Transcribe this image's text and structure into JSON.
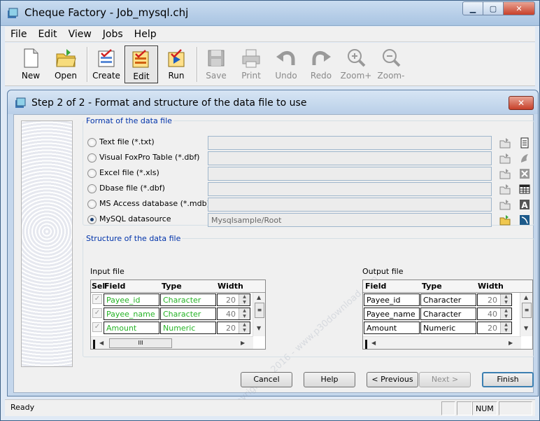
{
  "window": {
    "title": "Cheque Factory - Job_mysql.chj"
  },
  "menu": {
    "items": [
      "File",
      "Edit",
      "View",
      "Jobs",
      "Help"
    ]
  },
  "toolbar": {
    "buttons": [
      {
        "label": "New",
        "icon": "new-document-icon"
      },
      {
        "label": "Open",
        "icon": "open-folder-icon"
      },
      {
        "label": "Create",
        "icon": "create-check-icon"
      },
      {
        "label": "Edit",
        "icon": "edit-check-icon",
        "active": true
      },
      {
        "label": "Run",
        "icon": "run-icon"
      },
      {
        "label": "Save",
        "icon": "save-disk-icon",
        "disabled": true
      },
      {
        "label": "Print",
        "icon": "printer-icon",
        "disabled": true
      },
      {
        "label": "Undo",
        "icon": "undo-arrow-icon",
        "disabled": true
      },
      {
        "label": "Redo",
        "icon": "redo-arrow-icon",
        "disabled": true
      },
      {
        "label": "Zoom+",
        "icon": "zoom-in-icon",
        "disabled": true
      },
      {
        "label": "Zoom-",
        "icon": "zoom-out-icon",
        "disabled": true
      }
    ]
  },
  "dialog": {
    "title": "Step 2 of 2 - Format and structure of the data file to use",
    "format_group": {
      "legend": "Format of the data file",
      "options": [
        {
          "label": "Text file (*.txt)",
          "value": "",
          "checked": false,
          "icon": "notepad-icon"
        },
        {
          "label": "Visual FoxPro Table (*.dbf)",
          "value": "",
          "checked": false,
          "icon": "foxpro-icon"
        },
        {
          "label": "Excel file (*.xls)",
          "value": "",
          "checked": false,
          "icon": "excel-icon"
        },
        {
          "label": "Dbase file (*.dbf)",
          "value": "",
          "checked": false,
          "icon": "table-grid-icon"
        },
        {
          "label": "MS Access database (*.mdb)",
          "value": "",
          "checked": false,
          "icon": "access-icon"
        },
        {
          "label": "MySQL datasource",
          "value": "Mysqlsample/Root",
          "checked": true,
          "icon": "mysql-icon"
        }
      ]
    },
    "structure_group": {
      "legend": "Structure of the data file",
      "input": {
        "caption": "Input file",
        "headers": {
          "sel": "Sel",
          "field": "Field",
          "type": "Type",
          "width": "Width"
        },
        "rows": [
          {
            "field": "Payee_id",
            "type": "Character",
            "width": "20"
          },
          {
            "field": "Payee_name",
            "type": "Character",
            "width": "40"
          },
          {
            "field": "Amount",
            "type": "Numeric",
            "width": "20"
          }
        ],
        "hscroll_thumb": "III"
      },
      "output": {
        "caption": "Output file",
        "headers": {
          "field": "Field",
          "type": "Type",
          "width": "Width"
        },
        "rows": [
          {
            "field": "Payee_id",
            "type": "Character",
            "width": "20"
          },
          {
            "field": "Payee_name",
            "type": "Character",
            "width": "40"
          },
          {
            "field": "Amount",
            "type": "Numeric",
            "width": "20"
          }
        ]
      }
    },
    "buttons": {
      "cancel": "Cancel",
      "help": "Help",
      "previous": "< Previous",
      "next": "Next >",
      "finish": "Finish"
    }
  },
  "status": {
    "text": "Ready",
    "num": "NUM"
  },
  "watermark": "Copyright © 2016 - www.p30download.com"
}
